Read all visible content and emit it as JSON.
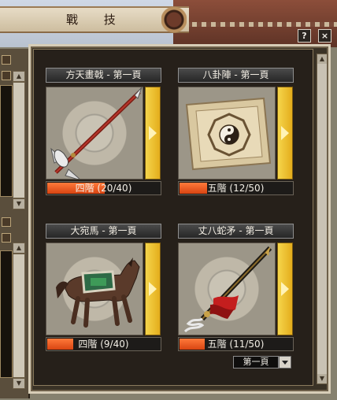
{
  "window": {
    "title": "戰 技",
    "help_label": "?",
    "close_label": "×"
  },
  "cards": [
    {
      "header": "方天畫戟 - 第一頁",
      "level_text": "四階 (20/40)",
      "progress": 0.5,
      "icon": "halberd-icon"
    },
    {
      "header": "八卦陣 - 第一頁",
      "level_text": "五階 (12/50)",
      "progress": 0.24,
      "icon": "bagua-scroll-icon"
    },
    {
      "header": "大宛馬 - 第一頁",
      "level_text": "四階 (9/40)",
      "progress": 0.225,
      "icon": "horse-icon"
    },
    {
      "header": "丈八蛇矛 - 第一頁",
      "level_text": "五階 (11/50)",
      "progress": 0.22,
      "icon": "serpent-spear-icon"
    }
  ],
  "page_select": {
    "value": "第一頁"
  },
  "colors": {
    "accent_yellow": "#e4ad1c",
    "progress_orange": "#e55a1e",
    "frame": "#d7cdb7"
  }
}
